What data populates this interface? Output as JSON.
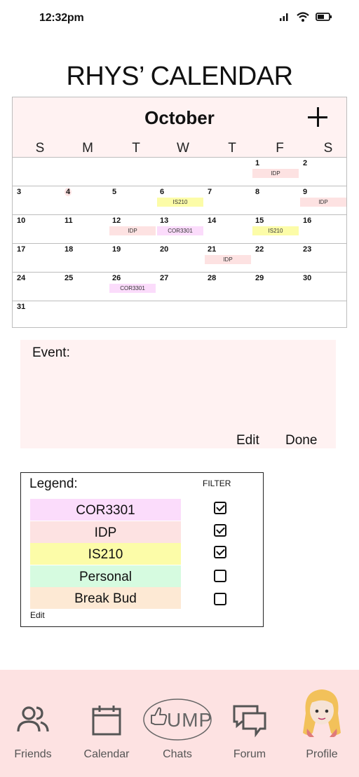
{
  "status": {
    "time": "12:32pm"
  },
  "title": "RHYS’ CALENDAR",
  "calendar": {
    "month": "October",
    "weekdays": [
      "S",
      "M",
      "T",
      "W",
      "T",
      "F",
      "S"
    ],
    "weeks": [
      [
        "",
        "",
        "",
        "",
        "",
        "1",
        "2"
      ],
      [
        "3",
        "4",
        "5",
        "6",
        "7",
        "8",
        "9"
      ],
      [
        "10",
        "11",
        "12",
        "13",
        "14",
        "15",
        "16"
      ],
      [
        "17",
        "18",
        "19",
        "20",
        "21",
        "22",
        "23"
      ],
      [
        "24",
        "25",
        "26",
        "27",
        "28",
        "29",
        "30"
      ],
      [
        "31",
        "",
        "",
        "",
        "",
        "",
        ""
      ]
    ],
    "events": [
      {
        "week": 0,
        "day": 5,
        "label": "IDP",
        "tag": "idp"
      },
      {
        "week": 1,
        "day": 3,
        "label": "IS210",
        "tag": "is"
      },
      {
        "week": 1,
        "day": 6,
        "label": "IDP",
        "tag": "idp"
      },
      {
        "week": 2,
        "day": 2,
        "label": "IDP",
        "tag": "idp"
      },
      {
        "week": 2,
        "day": 3,
        "label": "COR3301",
        "tag": "cor"
      },
      {
        "week": 2,
        "day": 5,
        "label": "IS210",
        "tag": "is"
      },
      {
        "week": 3,
        "day": 4,
        "label": "IDP",
        "tag": "idp"
      },
      {
        "week": 4,
        "day": 2,
        "label": "COR3301",
        "tag": "cor"
      }
    ],
    "highlighted_day": "4"
  },
  "event_panel": {
    "label": "Event:",
    "edit": "Edit",
    "done": "Done"
  },
  "legend": {
    "title": "Legend:",
    "filter_title": "FILTER",
    "edit": "Edit",
    "items": [
      {
        "label": "COR3301",
        "color": "#fbdcfb",
        "checked": true
      },
      {
        "label": "IDP",
        "color": "#fde2e2",
        "checked": true
      },
      {
        "label": "IS210",
        "color": "#fcfca8",
        "checked": true
      },
      {
        "label": "Personal",
        "color": "#d6fbe0",
        "checked": false
      },
      {
        "label": "Break Bud",
        "color": "#fde9d4",
        "checked": false
      }
    ]
  },
  "nav": {
    "items": [
      {
        "label": "Friends",
        "icon": "friends-icon"
      },
      {
        "label": "Calendar",
        "icon": "calendar-icon"
      },
      {
        "label": "Chats",
        "icon": "chats-icon",
        "logo_text": "UMP"
      },
      {
        "label": "Forum",
        "icon": "forum-icon"
      },
      {
        "label": "Profile",
        "icon": "profile-avatar-icon"
      }
    ]
  }
}
